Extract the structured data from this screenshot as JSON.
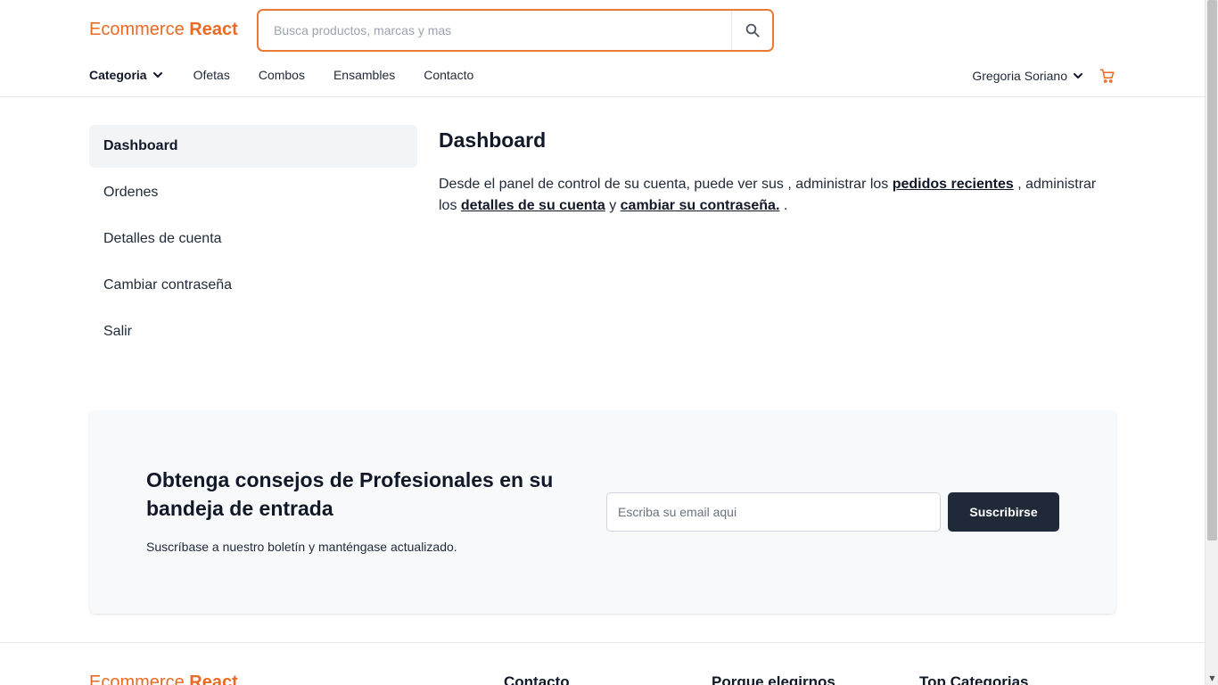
{
  "header": {
    "logo": {
      "light": "Ecommerce",
      "bold": "React"
    },
    "search": {
      "placeholder": "Busca productos, marcas y mas",
      "icon": "search-icon"
    },
    "nav": {
      "category_label": "Categoria",
      "links": [
        "Ofetas",
        "Combos",
        "Ensambles",
        "Contacto"
      ]
    },
    "user": {
      "name": "Gregoria Soriano",
      "cart_icon": "cart-icon"
    }
  },
  "sidebar": {
    "items": [
      {
        "label": "Dashboard",
        "active": true
      },
      {
        "label": "Ordenes",
        "active": false
      },
      {
        "label": "Detalles de cuenta",
        "active": false
      },
      {
        "label": "Cambiar contraseña",
        "active": false
      },
      {
        "label": "Salir",
        "active": false
      }
    ]
  },
  "main": {
    "title": "Dashboard",
    "intro": {
      "part1": "Desde el panel de control de su cuenta, puede ver sus , administrar los ",
      "link1": "pedidos recientes",
      "part2": " , administrar los ",
      "link2": "detalles de su cuenta",
      "part3": " y ",
      "link3": "cambiar su contraseña.",
      "part4": " ."
    }
  },
  "newsletter": {
    "title": "Obtenga consejos de Profesionales en su bandeja de entrada",
    "subtitle": "Suscríbase a nuestro boletín y manténgase actualizado.",
    "email_placeholder": "Escriba su email aqui",
    "button_label": "Suscribirse"
  },
  "footer": {
    "logo": {
      "light": "Ecommerce",
      "bold": "React"
    },
    "headings": [
      "Contacto",
      "Porque elegirnos",
      "Top Categorias"
    ]
  },
  "colors": {
    "accent": "#ea6a24",
    "search_border": "#ea7a36",
    "button_dark": "#1f2937",
    "active_bg": "#f3f4f6",
    "newsletter_bg": "#f8f9fb"
  }
}
